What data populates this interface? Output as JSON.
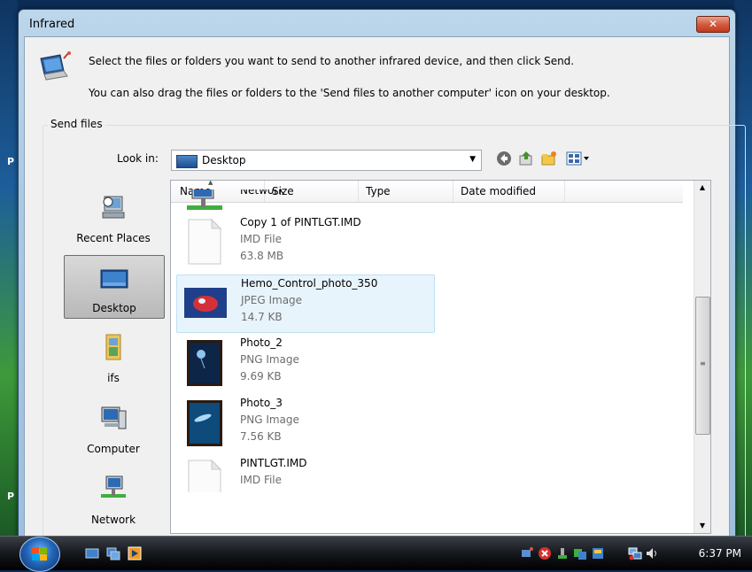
{
  "window": {
    "title": "Infrared",
    "close_label": "✕"
  },
  "instructions": {
    "line1": "Select the files or folders you want to send to another infrared device, and then click Send.",
    "line2": "You can also drag the files or folders to the 'Send files to another computer' icon on your desktop."
  },
  "send_files": {
    "group_label": "Send files",
    "look_in_label": "Look in:",
    "look_in_value": "Desktop"
  },
  "places": [
    {
      "label": "Recent Places"
    },
    {
      "label": "Desktop"
    },
    {
      "label": "ifs"
    },
    {
      "label": "Computer"
    },
    {
      "label": "Network"
    }
  ],
  "columns": [
    "Name",
    "Size",
    "Type",
    "Date modified"
  ],
  "files": [
    {
      "name": "Network",
      "type": "",
      "size": ""
    },
    {
      "name": "Copy 1 of PINTLGT.IMD",
      "type": "IMD File",
      "size": "63.8 MB"
    },
    {
      "name": "Hemo_Control_photo_350",
      "type": "JPEG Image",
      "size": "14.7 KB"
    },
    {
      "name": "Photo_2",
      "type": "PNG Image",
      "size": "9.69 KB"
    },
    {
      "name": "Photo_3",
      "type": "PNG Image",
      "size": "7.56 KB"
    },
    {
      "name": "PINTLGT.IMD",
      "type": "IMD File",
      "size": ""
    }
  ],
  "taskbar": {
    "clock": "6:37 PM"
  },
  "desktop_glyphs": [
    "P",
    "P"
  ]
}
